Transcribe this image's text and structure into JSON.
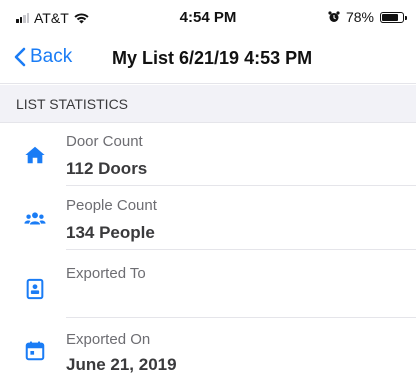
{
  "status_bar": {
    "carrier": "AT&T",
    "time": "4:54 PM",
    "battery": "78%"
  },
  "nav": {
    "back_label": "Back",
    "title": "My List 6/21/19 4:53 PM"
  },
  "section": {
    "header": "LIST STATISTICS"
  },
  "stats": [
    {
      "icon": "home-icon",
      "label": "Door Count",
      "value": "112 Doors"
    },
    {
      "icon": "people-icon",
      "label": "People Count",
      "value": "134 People"
    },
    {
      "icon": "contact-card-icon",
      "label": "Exported To",
      "value": ""
    },
    {
      "icon": "calendar-icon",
      "label": "Exported On",
      "value": "June 21, 2019"
    }
  ],
  "colors": {
    "accent": "#1a7cf5",
    "header_bg": "#f2f2f7"
  }
}
